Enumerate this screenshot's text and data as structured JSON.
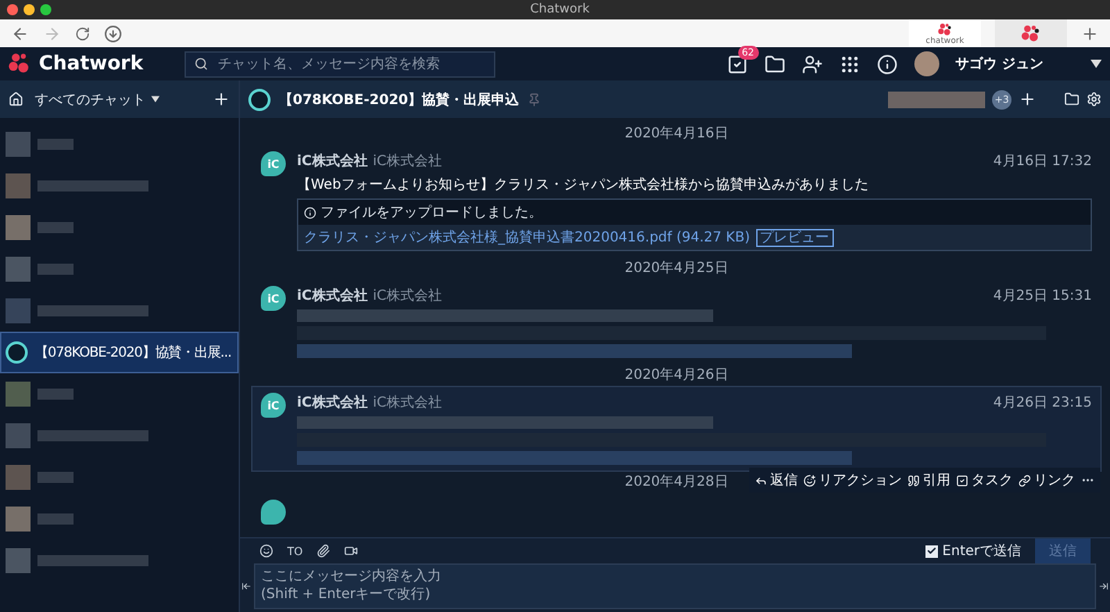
{
  "window": {
    "title": "Chatwork"
  },
  "browser": {
    "tabs": [
      {
        "kind": "labeled",
        "label": "chatwork",
        "selected": true
      },
      {
        "kind": "icon",
        "selected": false
      }
    ]
  },
  "header": {
    "logo_text": "Chatwork",
    "search": {
      "placeholder": "チャット名、メッセージ内容を検索"
    },
    "task_badge": "62",
    "user_name": "サゴウ ジュン"
  },
  "sidebar": {
    "filter": "すべてのチャット",
    "rooms": [
      {
        "kind": "blurred",
        "selected": false
      },
      {
        "kind": "blurred",
        "selected": false
      },
      {
        "kind": "blurred",
        "selected": false
      },
      {
        "kind": "blurred",
        "selected": false
      },
      {
        "kind": "blurred",
        "selected": false
      },
      {
        "kind": "room",
        "name": "【078KOBE-2020】協賛・出展...",
        "selected": true
      },
      {
        "kind": "blurred",
        "selected": false
      },
      {
        "kind": "blurred",
        "selected": false
      },
      {
        "kind": "blurred",
        "selected": false
      },
      {
        "kind": "blurred",
        "selected": false
      },
      {
        "kind": "blurred",
        "selected": false
      }
    ]
  },
  "room": {
    "title": "【078KOBE-2020】協賛・出展申込",
    "member_extra": "+3"
  },
  "timeline": [
    {
      "kind": "date",
      "text": "2020年4月16日"
    },
    {
      "kind": "message",
      "avatar": "iC",
      "sender": "iC株式会社",
      "org": "iC株式会社",
      "time": "4月16日 17:32",
      "highlighted": false,
      "blurred": false,
      "body": "【Webフォームよりお知らせ】クラリス・ジャパン株式会社様から協賛申込みがありました",
      "file": {
        "notice": "ファイルをアップロードしました。",
        "name": "クラリス・ジャパン株式会社様_協賛申込書20200416.pdf (94.27 KB)",
        "preview": "プレビュー"
      }
    },
    {
      "kind": "date",
      "text": "2020年4月25日"
    },
    {
      "kind": "message",
      "avatar": "iC",
      "sender": "iC株式会社",
      "org": "iC株式会社",
      "time": "4月25日 15:31",
      "highlighted": false,
      "blurred": true
    },
    {
      "kind": "date",
      "text": "2020年4月26日"
    },
    {
      "kind": "message",
      "avatar": "iC",
      "sender": "iC株式会社",
      "org": "iC株式会社",
      "time": "4月26日 23:15",
      "highlighted": true,
      "blurred": true
    },
    {
      "kind": "date",
      "text": "2020年4月28日"
    },
    {
      "kind": "partial"
    }
  ],
  "actions": [
    {
      "kind": "reply",
      "label": "返信"
    },
    {
      "kind": "reaction",
      "label": "リアクション"
    },
    {
      "kind": "quote",
      "label": "引用"
    },
    {
      "kind": "task",
      "label": "タスク"
    },
    {
      "kind": "link",
      "label": "リンク"
    }
  ],
  "composer": {
    "to": "TO",
    "enter_send": {
      "label": "Enterで送信",
      "checked": true
    },
    "send": {
      "label": "送信",
      "disabled": true
    },
    "placeholder": "ここにメッセージ内容を入力\n(Shift + Enterキーで改行)"
  }
}
